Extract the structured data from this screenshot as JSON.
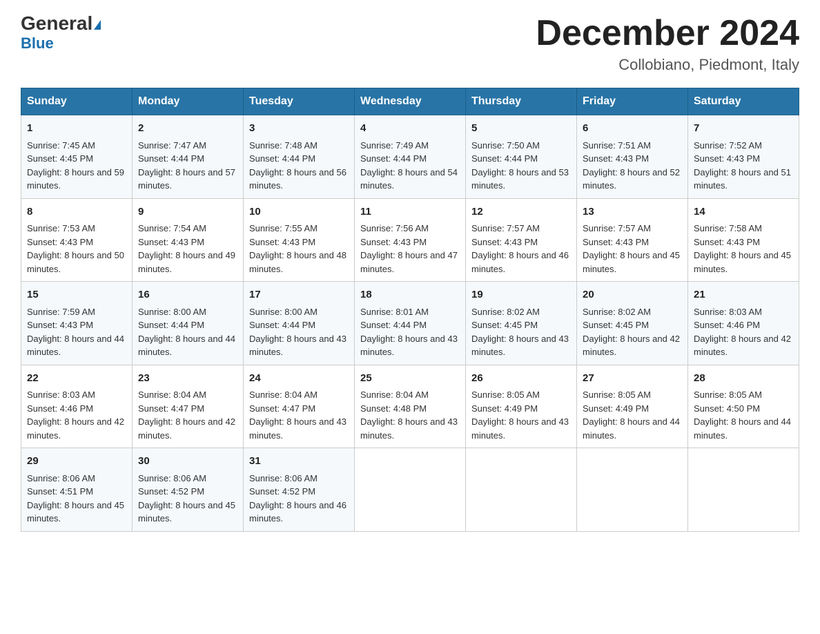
{
  "header": {
    "logo_line1": "General",
    "logo_line2": "Blue",
    "month_title": "December 2024",
    "location": "Collobiano, Piedmont, Italy"
  },
  "days_of_week": [
    "Sunday",
    "Monday",
    "Tuesday",
    "Wednesday",
    "Thursday",
    "Friday",
    "Saturday"
  ],
  "weeks": [
    [
      {
        "day": "1",
        "sunrise": "7:45 AM",
        "sunset": "4:45 PM",
        "daylight": "8 hours and 59 minutes."
      },
      {
        "day": "2",
        "sunrise": "7:47 AM",
        "sunset": "4:44 PM",
        "daylight": "8 hours and 57 minutes."
      },
      {
        "day": "3",
        "sunrise": "7:48 AM",
        "sunset": "4:44 PM",
        "daylight": "8 hours and 56 minutes."
      },
      {
        "day": "4",
        "sunrise": "7:49 AM",
        "sunset": "4:44 PM",
        "daylight": "8 hours and 54 minutes."
      },
      {
        "day": "5",
        "sunrise": "7:50 AM",
        "sunset": "4:44 PM",
        "daylight": "8 hours and 53 minutes."
      },
      {
        "day": "6",
        "sunrise": "7:51 AM",
        "sunset": "4:43 PM",
        "daylight": "8 hours and 52 minutes."
      },
      {
        "day": "7",
        "sunrise": "7:52 AM",
        "sunset": "4:43 PM",
        "daylight": "8 hours and 51 minutes."
      }
    ],
    [
      {
        "day": "8",
        "sunrise": "7:53 AM",
        "sunset": "4:43 PM",
        "daylight": "8 hours and 50 minutes."
      },
      {
        "day": "9",
        "sunrise": "7:54 AM",
        "sunset": "4:43 PM",
        "daylight": "8 hours and 49 minutes."
      },
      {
        "day": "10",
        "sunrise": "7:55 AM",
        "sunset": "4:43 PM",
        "daylight": "8 hours and 48 minutes."
      },
      {
        "day": "11",
        "sunrise": "7:56 AM",
        "sunset": "4:43 PM",
        "daylight": "8 hours and 47 minutes."
      },
      {
        "day": "12",
        "sunrise": "7:57 AM",
        "sunset": "4:43 PM",
        "daylight": "8 hours and 46 minutes."
      },
      {
        "day": "13",
        "sunrise": "7:57 AM",
        "sunset": "4:43 PM",
        "daylight": "8 hours and 45 minutes."
      },
      {
        "day": "14",
        "sunrise": "7:58 AM",
        "sunset": "4:43 PM",
        "daylight": "8 hours and 45 minutes."
      }
    ],
    [
      {
        "day": "15",
        "sunrise": "7:59 AM",
        "sunset": "4:43 PM",
        "daylight": "8 hours and 44 minutes."
      },
      {
        "day": "16",
        "sunrise": "8:00 AM",
        "sunset": "4:44 PM",
        "daylight": "8 hours and 44 minutes."
      },
      {
        "day": "17",
        "sunrise": "8:00 AM",
        "sunset": "4:44 PM",
        "daylight": "8 hours and 43 minutes."
      },
      {
        "day": "18",
        "sunrise": "8:01 AM",
        "sunset": "4:44 PM",
        "daylight": "8 hours and 43 minutes."
      },
      {
        "day": "19",
        "sunrise": "8:02 AM",
        "sunset": "4:45 PM",
        "daylight": "8 hours and 43 minutes."
      },
      {
        "day": "20",
        "sunrise": "8:02 AM",
        "sunset": "4:45 PM",
        "daylight": "8 hours and 42 minutes."
      },
      {
        "day": "21",
        "sunrise": "8:03 AM",
        "sunset": "4:46 PM",
        "daylight": "8 hours and 42 minutes."
      }
    ],
    [
      {
        "day": "22",
        "sunrise": "8:03 AM",
        "sunset": "4:46 PM",
        "daylight": "8 hours and 42 minutes."
      },
      {
        "day": "23",
        "sunrise": "8:04 AM",
        "sunset": "4:47 PM",
        "daylight": "8 hours and 42 minutes."
      },
      {
        "day": "24",
        "sunrise": "8:04 AM",
        "sunset": "4:47 PM",
        "daylight": "8 hours and 43 minutes."
      },
      {
        "day": "25",
        "sunrise": "8:04 AM",
        "sunset": "4:48 PM",
        "daylight": "8 hours and 43 minutes."
      },
      {
        "day": "26",
        "sunrise": "8:05 AM",
        "sunset": "4:49 PM",
        "daylight": "8 hours and 43 minutes."
      },
      {
        "day": "27",
        "sunrise": "8:05 AM",
        "sunset": "4:49 PM",
        "daylight": "8 hours and 44 minutes."
      },
      {
        "day": "28",
        "sunrise": "8:05 AM",
        "sunset": "4:50 PM",
        "daylight": "8 hours and 44 minutes."
      }
    ],
    [
      {
        "day": "29",
        "sunrise": "8:06 AM",
        "sunset": "4:51 PM",
        "daylight": "8 hours and 45 minutes."
      },
      {
        "day": "30",
        "sunrise": "8:06 AM",
        "sunset": "4:52 PM",
        "daylight": "8 hours and 45 minutes."
      },
      {
        "day": "31",
        "sunrise": "8:06 AM",
        "sunset": "4:52 PM",
        "daylight": "8 hours and 46 minutes."
      },
      null,
      null,
      null,
      null
    ]
  ]
}
